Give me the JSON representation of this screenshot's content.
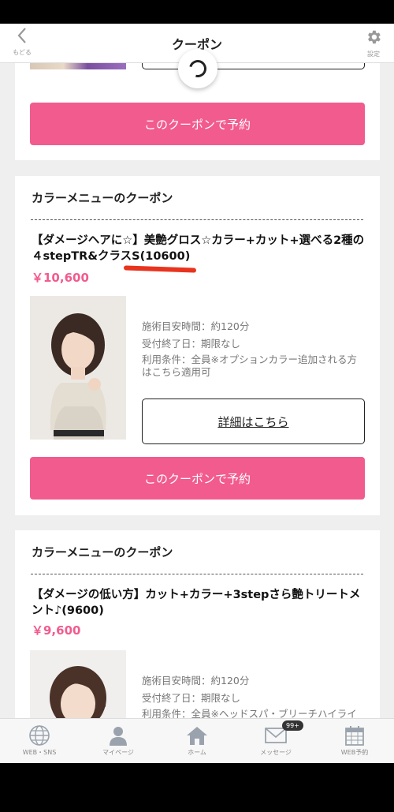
{
  "header": {
    "title": "クーポン",
    "back_label": "もどる",
    "settings_label": "設定"
  },
  "top_card": {
    "book_label": "このクーポンで予約"
  },
  "coupons": [
    {
      "section_title": "カラーメニューのクーポン",
      "name": "【ダメージヘアに☆】美艶グロス☆カラー+カット+選べる2種の４stepTR&クラスS(10600)",
      "price": "￥10,600",
      "time": "施術目安時間：約120分",
      "deadline": "受付終了日：期限なし",
      "conditions": "利用条件：全員※オプションカラー追加される方はこちら適用可",
      "detail_label": "詳細はこちら",
      "book_label": "このクーポンで予約"
    },
    {
      "section_title": "カラーメニューのクーポン",
      "name": "【ダメージの低い方】カット+カラー+3stepさら艶トリートメント♪(9600)",
      "price": "￥9,600",
      "time": "施術目安時間：約120分",
      "deadline": "受付終了日：期限なし",
      "conditions": "利用条件：全員※ヘッドスパ・ブリーチハイライトなどオプションカラー追加不可、TR変更不可"
    }
  ],
  "tabbar": {
    "items": [
      {
        "label": "WEB・SNS",
        "icon": "globe-icon"
      },
      {
        "label": "マイページ",
        "icon": "person-icon"
      },
      {
        "label": "ホーム",
        "icon": "home-icon"
      },
      {
        "label": "メッセージ",
        "icon": "mail-icon",
        "badge": "99+"
      },
      {
        "label": "WEB予約",
        "icon": "calendar-icon"
      }
    ]
  },
  "colors": {
    "accent": "#f25b8d",
    "background": "#efefef"
  }
}
